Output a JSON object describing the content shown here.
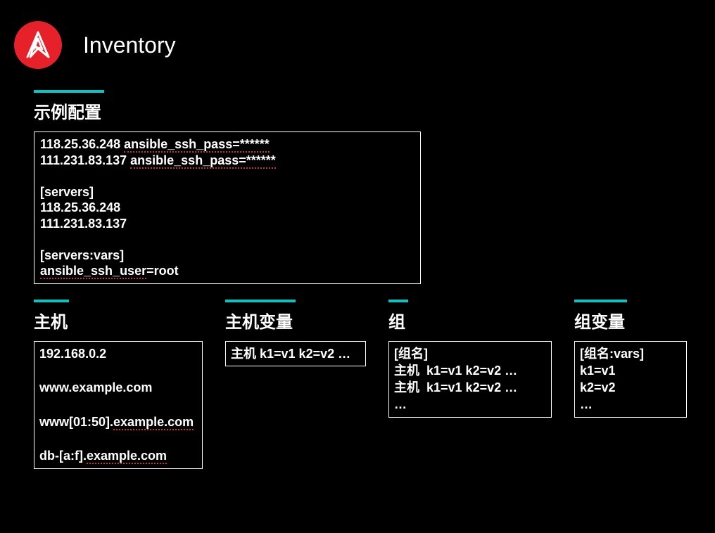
{
  "header": {
    "title": "Inventory"
  },
  "example": {
    "heading": "示例配置",
    "line1": "118.25.36.248 ",
    "line1_u": "ansible_ssh_pass=******",
    "line2": "111.231.83.137 ",
    "line2_u": "ansible_ssh_pass=******",
    "servers_header": "[servers]",
    "server_ip1": "118.25.36.248",
    "server_ip2": "111.231.83.137",
    "vars_header": "[servers:vars]",
    "vars_line_u": "ansible_ssh_user",
    "vars_line_rest": "=root"
  },
  "col1": {
    "heading": "主机",
    "l1": "192.168.0.2",
    "l2": "www.example.com",
    "l3": "www[01:50].",
    "l3_u": "example.com",
    "l4": "db-[a:f].",
    "l4_u": "example.com"
  },
  "col2": {
    "heading": "主机变量",
    "l1": "主机 k1=v1 k2=v2 …"
  },
  "col3": {
    "heading": "组",
    "l1": "[组名]",
    "l2": "主机  k1=v1 k2=v2 …",
    "l3": "主机  k1=v1 k2=v2 …",
    "l4": "…"
  },
  "col4": {
    "heading": "组变量",
    "l1": "[组名:vars]",
    "l2": "k1=v1",
    "l3": "k2=v2",
    "l4": "…"
  }
}
